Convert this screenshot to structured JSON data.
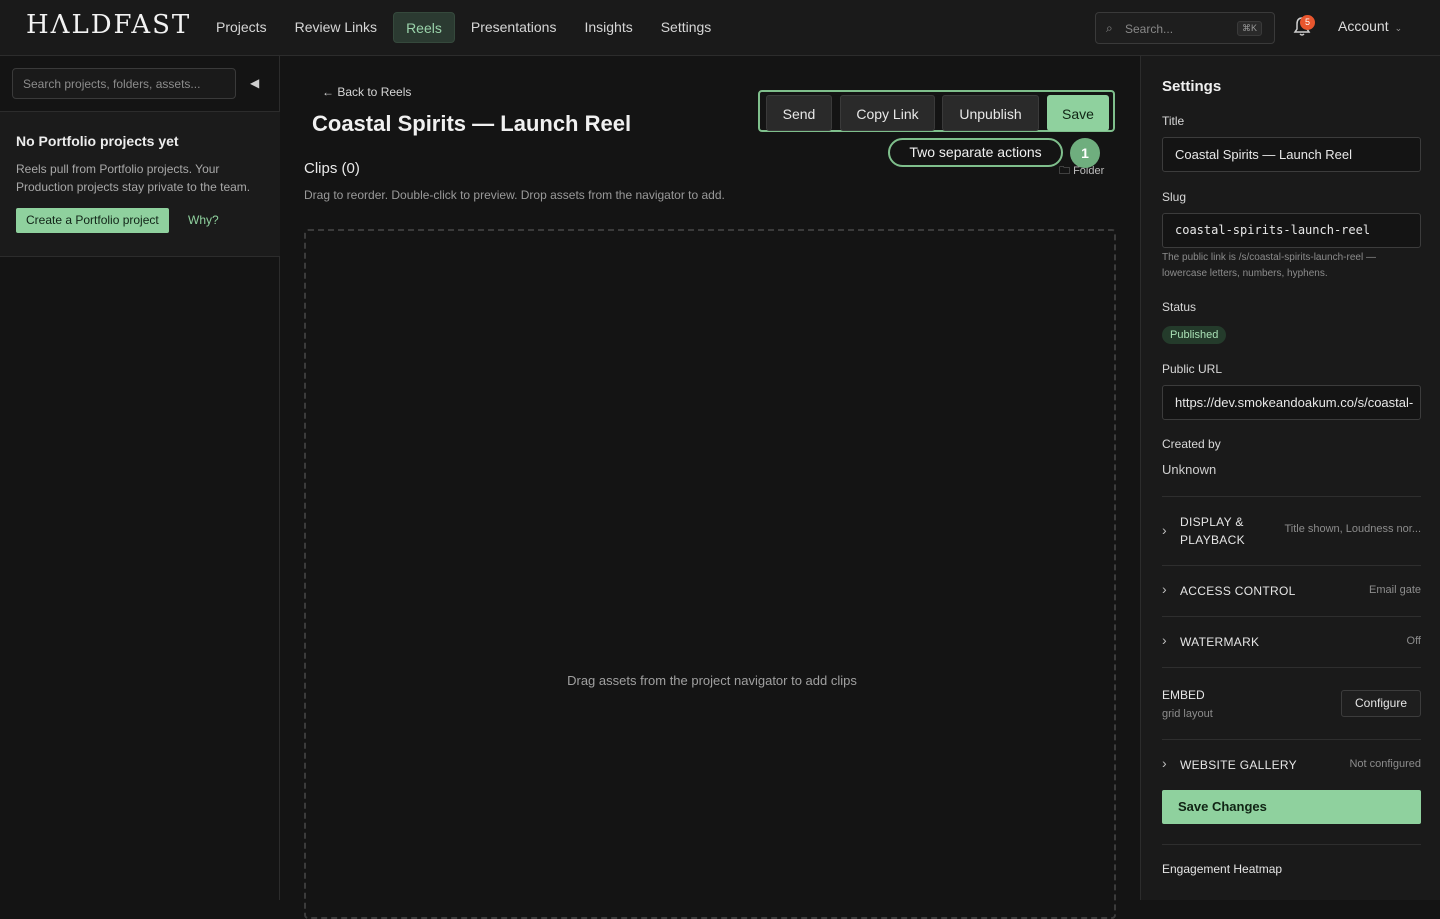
{
  "brand": {
    "logo": "HɅLDFAST"
  },
  "nav": [
    {
      "label": "Projects",
      "active": false
    },
    {
      "label": "Review Links",
      "active": false
    },
    {
      "label": "Reels",
      "active": true
    },
    {
      "label": "Presentations",
      "active": false
    },
    {
      "label": "Insights",
      "active": false
    },
    {
      "label": "Settings",
      "active": false
    }
  ],
  "topbar": {
    "search_placeholder": "Search...",
    "search_shortcut": "⌘K",
    "notifications_count": "5",
    "account_label": "Account"
  },
  "sidebar": {
    "search_placeholder": "Search projects, folders, assets...",
    "collapse_glyph": "◀",
    "empty_title": "No Portfolio projects yet",
    "empty_desc": "Reels pull from Portfolio projects. Your Production projects stay private to the team.",
    "create_label": "Create a Portfolio project",
    "why_label": "Why?"
  },
  "main": {
    "back_label": "← Back to Reels",
    "title": "Coastal Spirits — Launch Reel",
    "actions": {
      "send": "Send",
      "copy_link": "Copy Link",
      "unpublish": "Unpublish",
      "save": "Save"
    },
    "annotation_note": "Two separate actions",
    "annotation_step": "1",
    "folder_label": "Folder",
    "clips_heading": "Clips (0)",
    "clips_help": "Drag to reorder. Double-click to preview. Drop assets from the navigator to add.",
    "drop_text": "Drag assets from the project navigator to add clips"
  },
  "settings": {
    "heading": "Settings",
    "title_label": "Title",
    "title_value": "Coastal Spirits — Launch Reel",
    "slug_label": "Slug",
    "slug_value": "coastal-spirits-launch-reel",
    "slug_hint": "The public link is /s/coastal-spirits-launch-reel — lowercase letters, numbers, hyphens.",
    "status_label": "Status",
    "status_value": "Published",
    "public_url_label": "Public URL",
    "public_url_value": "https://dev.smokeandoakum.co/s/coastal-",
    "created_by_label": "Created by",
    "created_by_value": "Unknown",
    "sections": {
      "display": {
        "name": "DISPLAY & PLAYBACK",
        "summary": "Title shown, Loudness nor..."
      },
      "access": {
        "name": "ACCESS CONTROL",
        "summary": "Email gate"
      },
      "watermark": {
        "name": "WATERMARK",
        "summary": "Off"
      },
      "gallery": {
        "name": "WEBSITE GALLERY",
        "summary": "Not configured"
      }
    },
    "embed_name": "EMBED",
    "embed_sub": "grid layout",
    "configure_label": "Configure",
    "save_changes_label": "Save Changes",
    "heatmap_label": "Engagement Heatmap"
  },
  "colors": {
    "accent": "#8fd19e",
    "annotation": "#7fbf8c",
    "badge": "#e8562e"
  }
}
